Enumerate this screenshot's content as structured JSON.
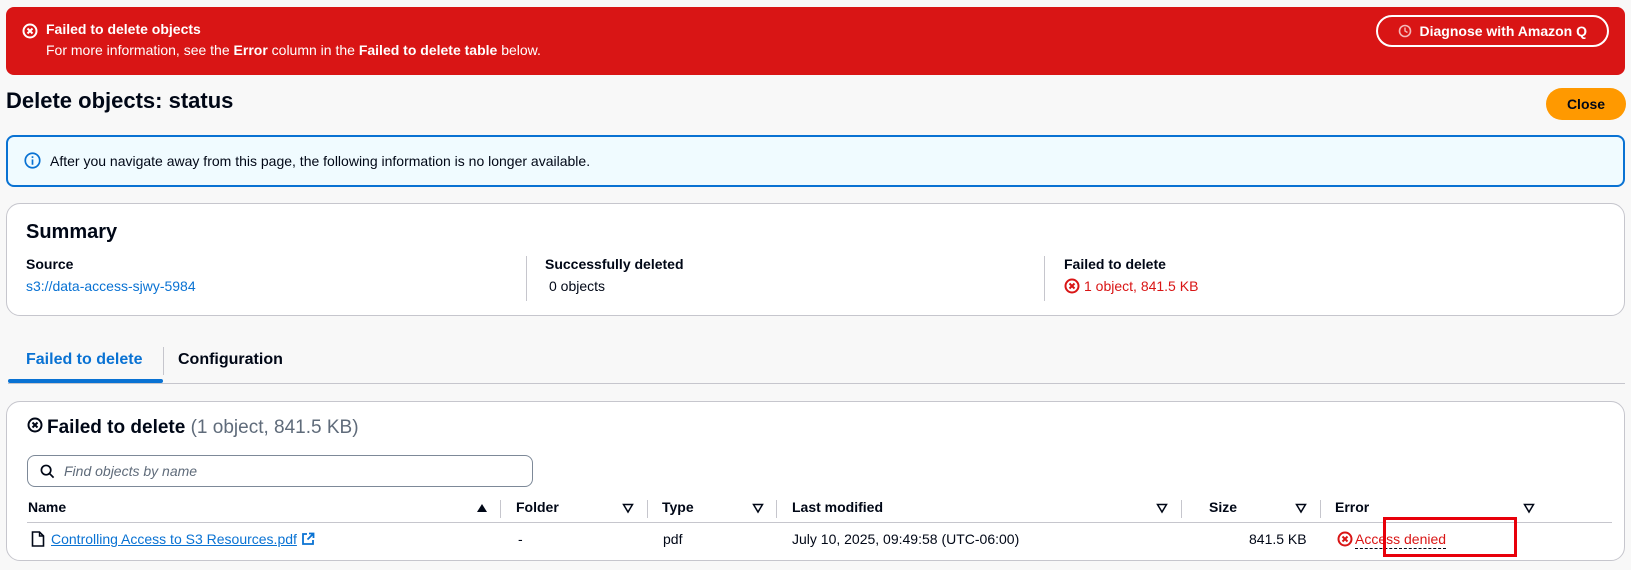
{
  "flash": {
    "title": "Failed to delete objects",
    "msg_prefix": "For more information, see the ",
    "msg_error_word": "Error",
    "msg_middle": " column in the ",
    "msg_table_word": "Failed to delete table",
    "msg_suffix": " below.",
    "diagnose_label": "Diagnose with Amazon Q",
    "color": "#d91515"
  },
  "page": {
    "title": "Delete objects: status",
    "close_label": "Close"
  },
  "info": {
    "text": "After you navigate away from this page, the following information is no longer available."
  },
  "summary": {
    "heading": "Summary",
    "source_label": "Source",
    "source_value": "s3://data-access-sjwy-5984",
    "success_label": "Successfully deleted",
    "success_value": "0 objects",
    "failed_label": "Failed to delete",
    "failed_value": "1 object, 841.5 KB"
  },
  "tabs": [
    {
      "label": "Failed to delete",
      "active": true
    },
    {
      "label": "Configuration",
      "active": false
    }
  ],
  "failed_panel": {
    "heading": "Failed to delete",
    "count": "(1 object, 841.5 KB)",
    "search_placeholder": "Find objects by name",
    "columns": [
      "Name",
      "Folder",
      "Type",
      "Last modified",
      "Size",
      "Error"
    ],
    "rows": [
      {
        "name": "Controlling Access to S3 Resources.pdf",
        "folder": "-",
        "type": "pdf",
        "last_modified": "July 10, 2025, 09:49:58 (UTC-06:00)",
        "size": "841.5 KB",
        "error": "Access denied"
      }
    ]
  },
  "colors": {
    "accent": "#0972d3",
    "error": "#d91515",
    "primary_button": "#ff9900"
  }
}
